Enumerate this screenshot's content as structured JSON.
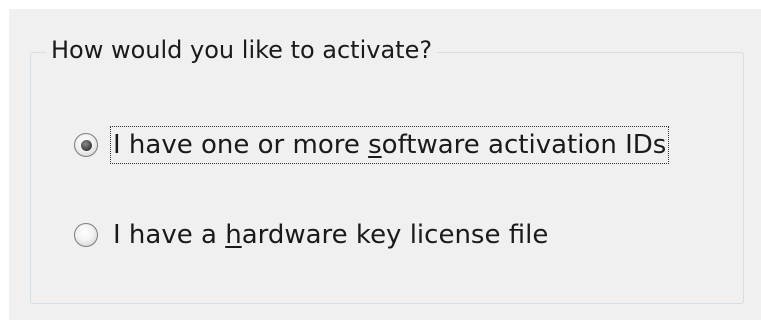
{
  "groupbox": {
    "title": "How would you like to activate?"
  },
  "options": [
    {
      "label_before": "I have one or more ",
      "label_mnemonic": "s",
      "label_after": "oftware activation IDs",
      "selected": true
    },
    {
      "label_before": "I have a ",
      "label_mnemonic": "h",
      "label_after": "ardware key license file",
      "selected": false
    }
  ]
}
